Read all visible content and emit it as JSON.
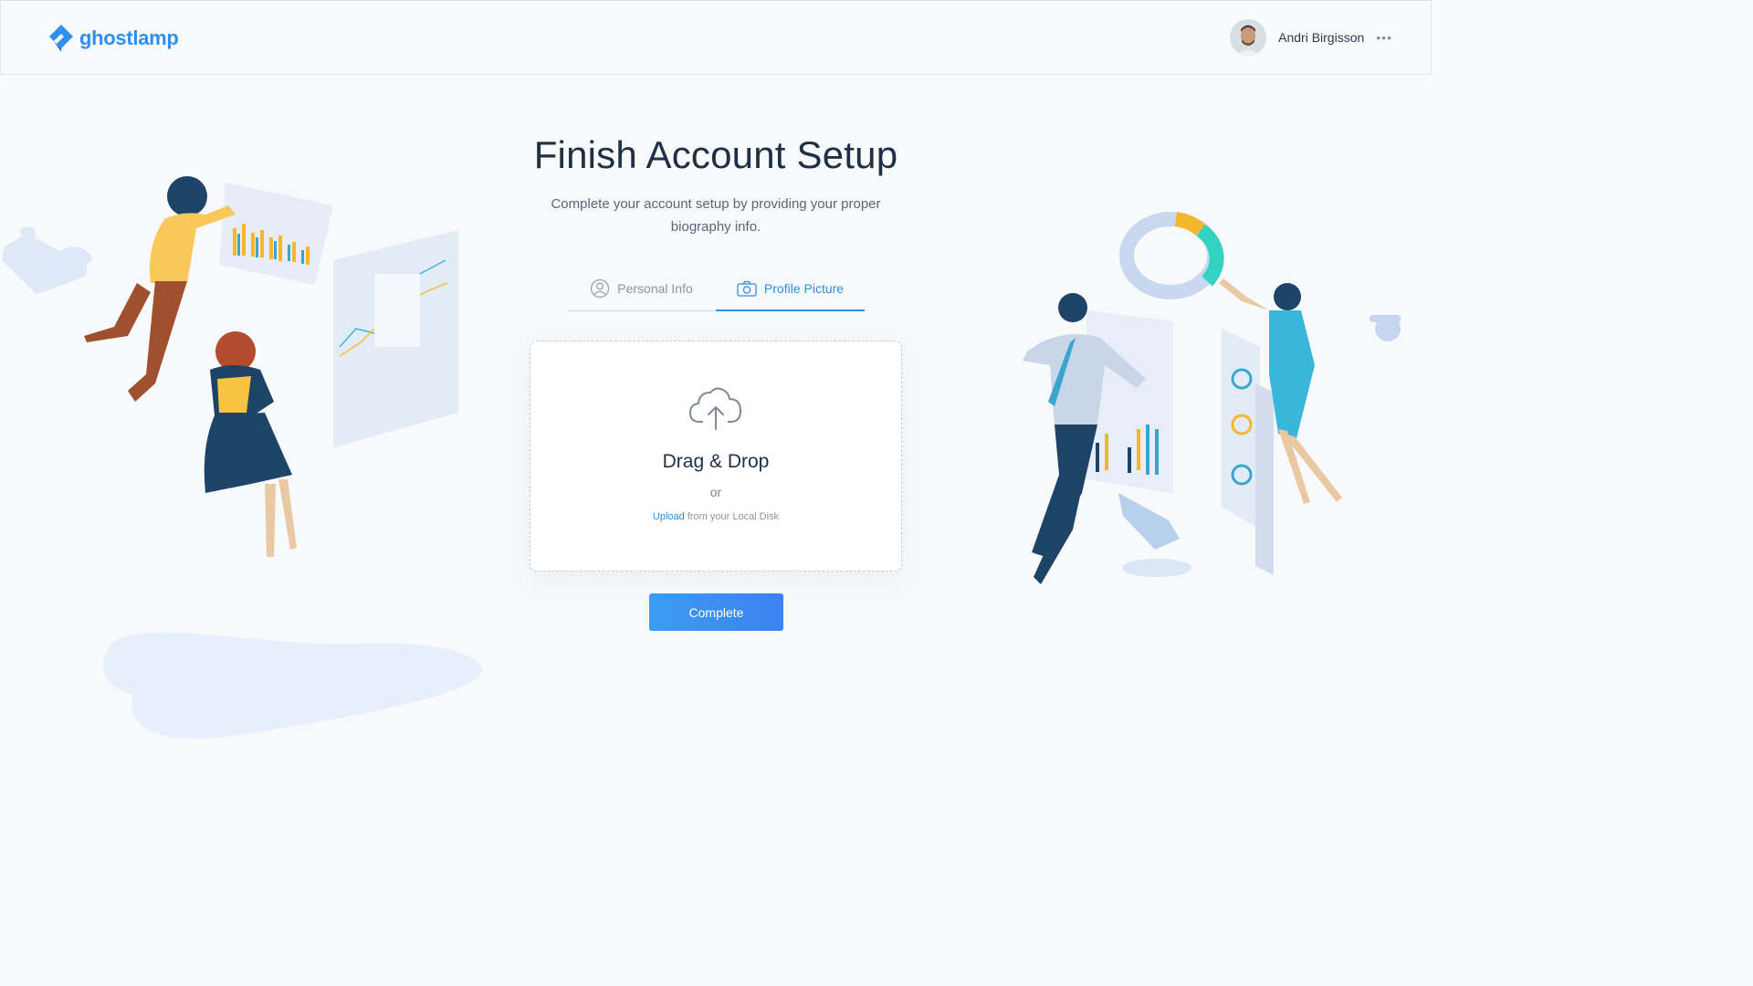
{
  "header": {
    "logo_text": "ghostlamp",
    "user_name": "Andri Birgisson",
    "more_label": "•••"
  },
  "main": {
    "title": "Finish Account Setup",
    "subtitle": "Complete your account setup by providing your proper biography info.",
    "tabs": [
      {
        "label": "Personal Info",
        "icon": "user-circle-icon",
        "active": false
      },
      {
        "label": "Profile Picture",
        "icon": "camera-icon",
        "active": true
      }
    ],
    "dropzone": {
      "title": "Drag & Drop",
      "or_text": "or",
      "upload_link": "Upload",
      "upload_rest": " from your Local Disk",
      "icon": "cloud-upload-icon"
    },
    "complete_label": "Complete"
  },
  "colors": {
    "accent": "#2d8fe8",
    "background": "#f7f9fb",
    "heading": "#1f2f46"
  }
}
